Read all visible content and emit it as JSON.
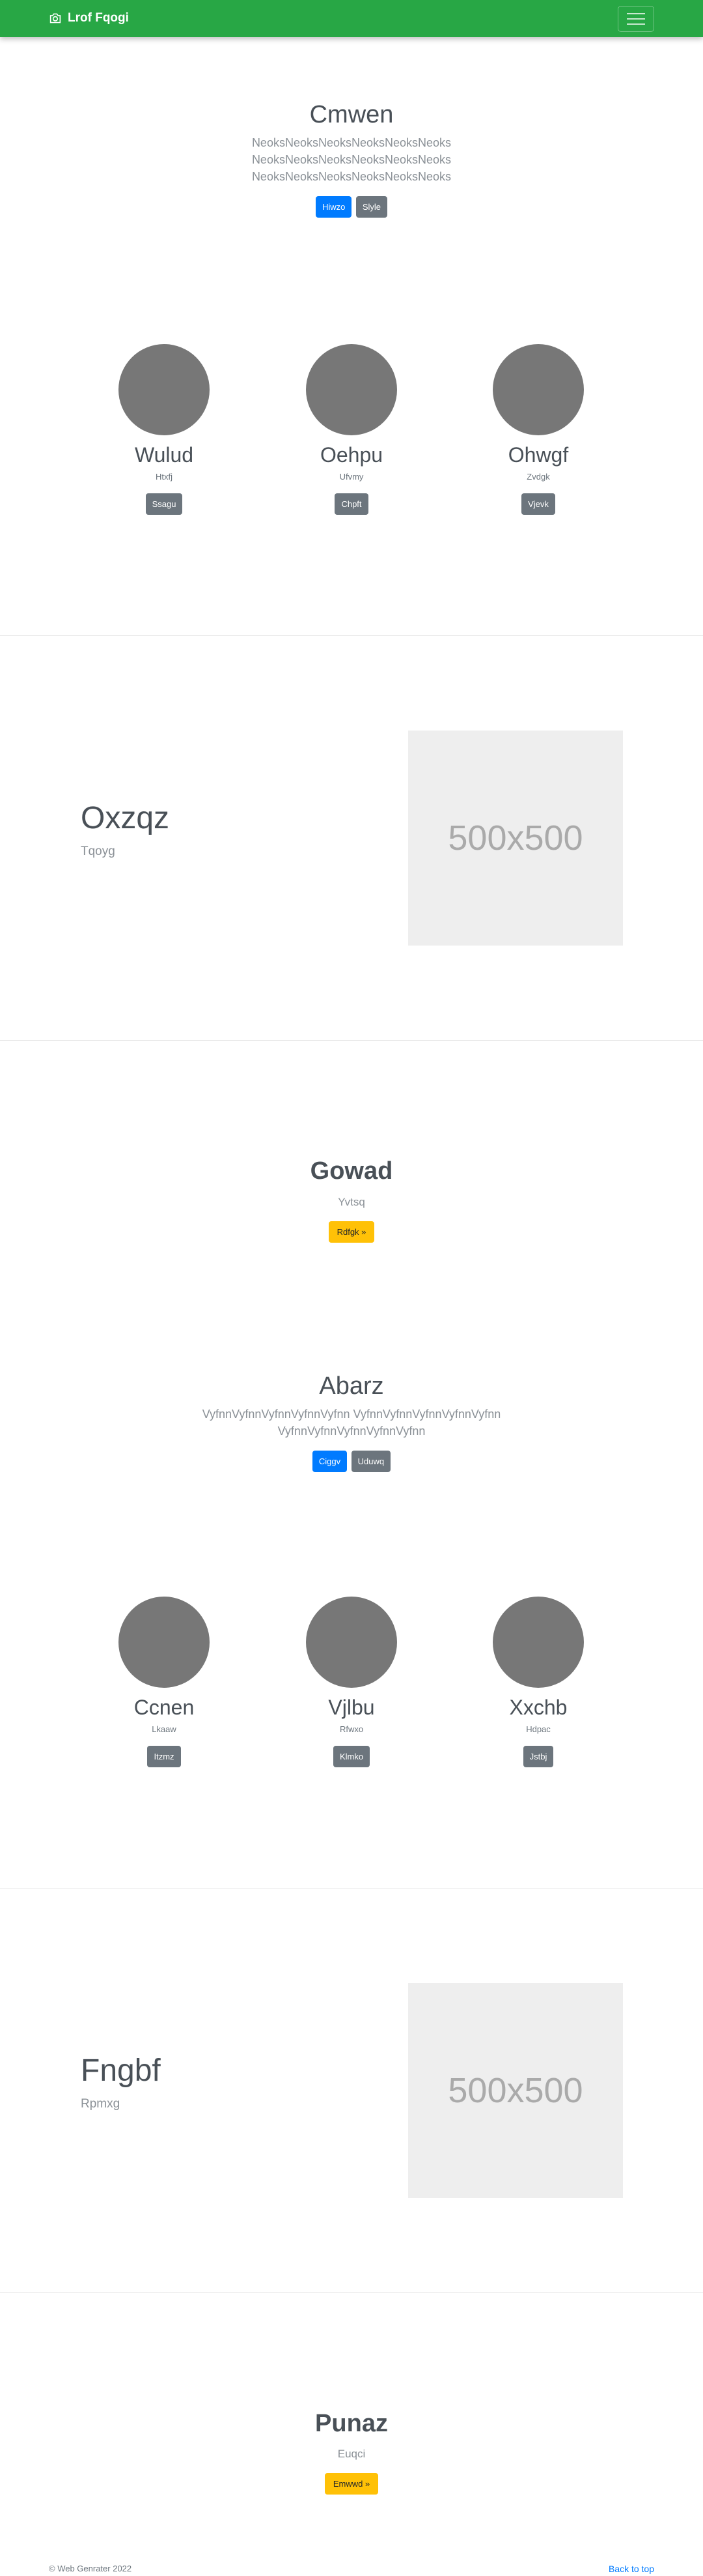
{
  "navbar": {
    "brand": "Lrof Fqogi",
    "brand_icon": "camera-icon"
  },
  "hero1": {
    "title": "Cmwen",
    "lead_lines": [
      "NeoksNeoksNeoksNeoksNeoksNeoks",
      "NeoksNeoksNeoksNeoksNeoksNeoks",
      "NeoksNeoksNeoksNeoksNeoksNeoks"
    ],
    "buttons": [
      "Hiwzo",
      "Slyle"
    ]
  },
  "people1": [
    {
      "name": "Wulud",
      "desc": "Htxfj",
      "button": "Ssagu"
    },
    {
      "name": "Oehpu",
      "desc": "Ufvmy",
      "button": "Chpft"
    },
    {
      "name": "Ohwgf",
      "desc": "Zvdgk",
      "button": "Vjevk"
    }
  ],
  "feature1": {
    "title": "Oxzqz",
    "subtitle": "Tqoyg",
    "image_label": "500x500"
  },
  "cta1": {
    "title": "Gowad",
    "subtitle": "Yvtsq",
    "button": "Rdfgk »"
  },
  "hero2": {
    "title": "Abarz",
    "lead_lines": [
      "VyfnnVyfnnVyfnnVyfnnVyfnn VyfnnVyfnnVyfnnVyfnnVyfnn",
      "VyfnnVyfnnVyfnnVyfnnVyfnn"
    ],
    "buttons": [
      "Ciggv",
      "Uduwq"
    ]
  },
  "people2": [
    {
      "name": "Ccnen",
      "desc": "Lkaaw",
      "button": "Itzmz"
    },
    {
      "name": "Vjlbu",
      "desc": "Rfwxo",
      "button": "Klmko"
    },
    {
      "name": "Xxchb",
      "desc": "Hdpac",
      "button": "Jstbj"
    }
  ],
  "feature2": {
    "title": "Fngbf",
    "subtitle": "Rpmxg",
    "image_label": "500x500"
  },
  "cta2": {
    "title": "Punaz",
    "subtitle": "Euqci",
    "button": "Emwwd »"
  },
  "footer": {
    "copyright": "© Web Genrater 2022",
    "back_to_top": "Back to top"
  }
}
